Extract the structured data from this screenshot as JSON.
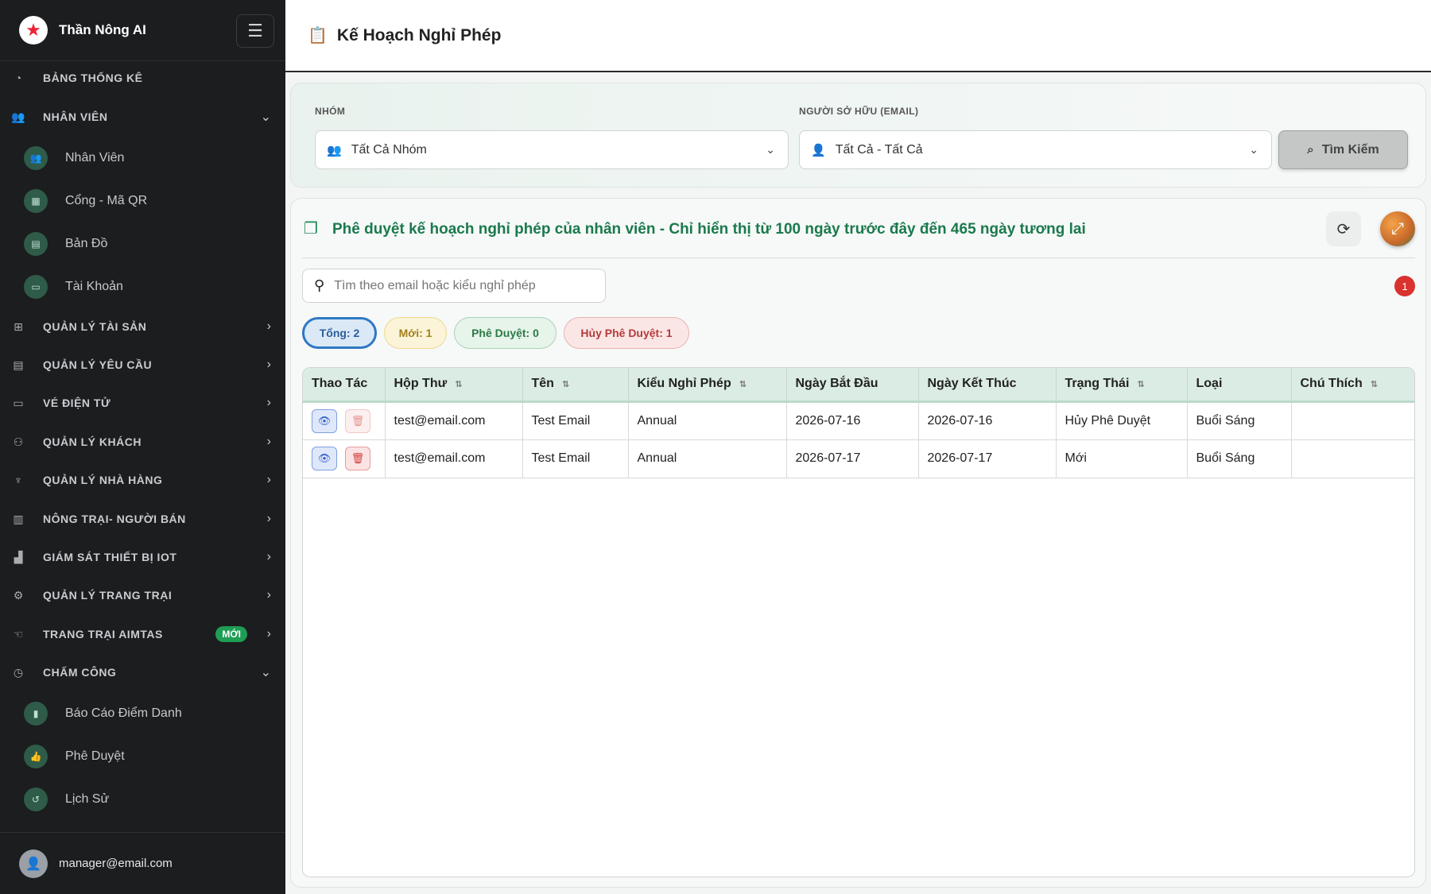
{
  "app": {
    "name": "Thần Nông AI",
    "logo_icon": "star-logo-icon"
  },
  "sidebar": {
    "groups": [
      {
        "label": "BẢNG THỐNG KÊ",
        "icon": "gauge-icon"
      },
      {
        "label": "NHÂN VIÊN",
        "icon": "users-icon",
        "expanded": true
      },
      {
        "label": "QUẢN LÝ TÀI SẢN",
        "icon": "sitemap-icon"
      },
      {
        "label": "QUẢN LÝ YÊU CẦU",
        "icon": "clipboard-icon"
      },
      {
        "label": "VÉ ĐIỆN TỬ",
        "icon": "ticket-icon"
      },
      {
        "label": "QUẢN LÝ KHÁCH",
        "icon": "guests-icon"
      },
      {
        "label": "QUẢN LÝ NHÀ HÀNG",
        "icon": "utensils-icon"
      },
      {
        "label": "NÔNG TRẠI- NGƯỜI BÁN",
        "icon": "store-icon"
      },
      {
        "label": "GIÁM SÁT THIẾT BỊ IOT",
        "icon": "industry-icon"
      },
      {
        "label": "QUẢN LÝ TRANG TRẠI",
        "icon": "tractor-icon"
      },
      {
        "label": "TRANG TRẠI AIMTAS",
        "icon": "hand-icon",
        "badge": "MỚI"
      },
      {
        "label": "CHẤM CÔNG",
        "icon": "clock-icon",
        "expanded": true
      }
    ],
    "staff_items": [
      {
        "label": "Nhân Viên",
        "icon": "users-icon"
      },
      {
        "label": "Cổng - Mã QR",
        "icon": "qr-icon"
      },
      {
        "label": "Bản Đồ",
        "icon": "map-icon"
      },
      {
        "label": "Tài Khoản",
        "icon": "id-card-icon"
      }
    ],
    "attendance_items": [
      {
        "label": "Báo Cáo Điểm Danh",
        "icon": "chart-icon"
      },
      {
        "label": "Phê Duyệt",
        "icon": "thumbs-up-icon"
      },
      {
        "label": "Lịch Sử",
        "icon": "history-icon"
      }
    ],
    "user_email": "manager@email.com"
  },
  "header": {
    "title": "Kế Hoạch Nghỉ Phép"
  },
  "filters": {
    "group_label": "NHÓM",
    "group_value": "Tất Cả Nhóm",
    "owner_label": "NGƯỜI SỞ HỮU (EMAIL)",
    "owner_value": "Tất Cả - Tất Cả",
    "search_button": "Tìm Kiếm"
  },
  "content": {
    "title": "Phê duyệt kế hoạch nghỉ phép của nhân viên - Chỉ hiển thị từ 100 ngày trước đây đến 465 ngày tương lai",
    "search_placeholder": "Tìm theo email hoặc kiểu nghỉ phép",
    "notification_count": "1",
    "pills": {
      "total": "Tổng: 2",
      "new": "Mới: 1",
      "approved": "Phê Duyệt: 0",
      "cancelled": "Hủy Phê Duyệt: 1"
    }
  },
  "table": {
    "columns": [
      "Thao Tác",
      "Hộp Thư",
      "Tên",
      "Kiểu Nghỉ Phép",
      "Ngày Bắt Đầu",
      "Ngày Kết Thúc",
      "Trạng Thái",
      "Loại",
      "Chú Thích"
    ],
    "rows": [
      {
        "email": "test@email.com",
        "name": "Test Email",
        "type": "Annual",
        "start": "2026-07-16",
        "end": "2026-07-16",
        "status": "Hủy Phê Duyệt",
        "kind": "Buổi Sáng",
        "note": ""
      },
      {
        "email": "test@email.com",
        "name": "Test Email",
        "type": "Annual",
        "start": "2026-07-17",
        "end": "2026-07-17",
        "status": "Mới",
        "kind": "Buổi Sáng",
        "note": ""
      }
    ]
  }
}
